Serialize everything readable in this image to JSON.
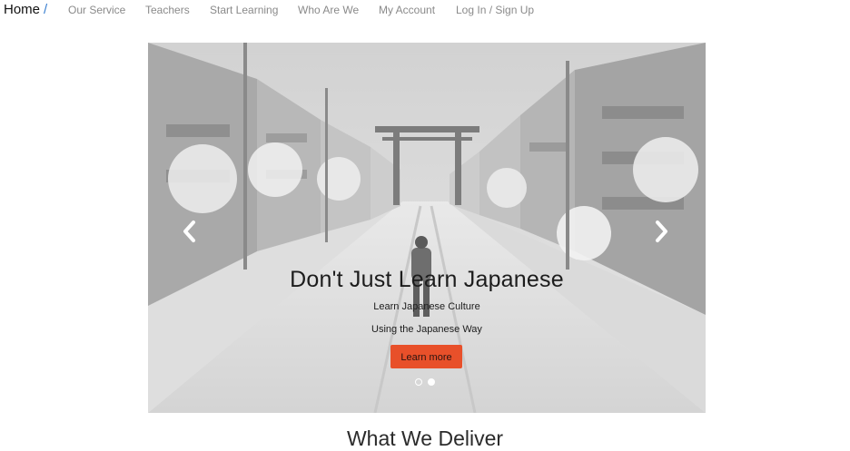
{
  "nav": {
    "home_label": "Home",
    "home_separator": "/",
    "items": [
      {
        "label": "Our Service"
      },
      {
        "label": "Teachers"
      },
      {
        "label": "Start Learning"
      },
      {
        "label": "Who Are We"
      },
      {
        "label": "My Account"
      },
      {
        "label": "Log In / Sign Up"
      }
    ]
  },
  "carousel": {
    "title": "Don't Just Learn Japanese",
    "line1": "Learn Japanese Culture",
    "line2": "Using the Japanese Way",
    "button_label": "Learn more",
    "prev_icon": "chevron-left-icon",
    "next_icon": "chevron-right-icon",
    "slides_count": 2,
    "active_slide": 2
  },
  "section": {
    "title": "What We Deliver"
  },
  "colors": {
    "accent": "#e8502a",
    "home_separator": "#3a7fd0",
    "nav_text": "#8a8a8a"
  }
}
